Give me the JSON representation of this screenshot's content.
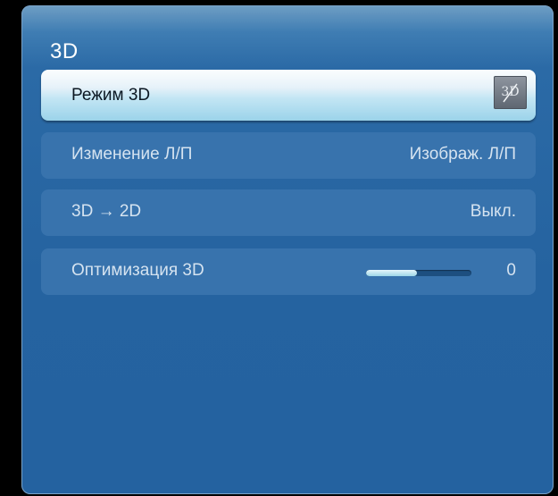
{
  "menu": {
    "title": "3D",
    "items": [
      {
        "label": "Режим 3D",
        "icon": "3d-off-icon",
        "icon_text": "3D"
      },
      {
        "label": "Изменение Л/П",
        "value": "Изображ. Л/П"
      },
      {
        "label": "3D → 2D",
        "value": "Выкл."
      },
      {
        "label": "Оптимизация 3D",
        "value": "0",
        "slider_fraction": 0.48
      }
    ]
  },
  "colors": {
    "panel": "#2563a0",
    "row": "#3873ad",
    "highlight": "#c4e6f4"
  }
}
